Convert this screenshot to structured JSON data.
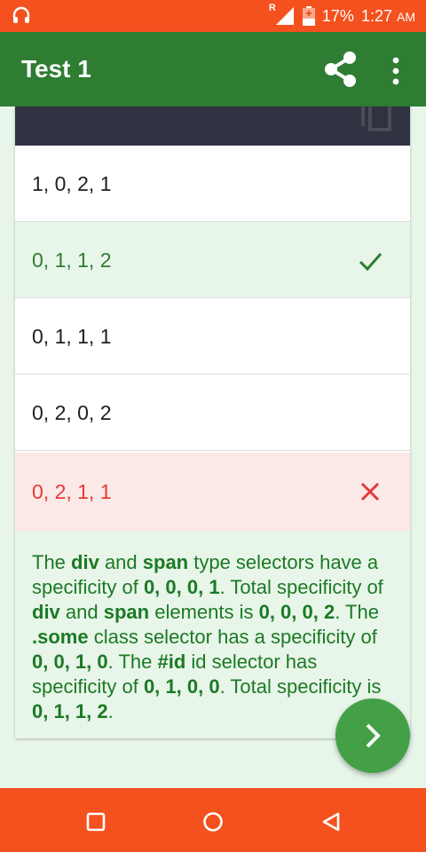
{
  "status_bar": {
    "roaming_label": "R",
    "battery": "17%",
    "time": "1:27",
    "time_suffix": "AM",
    "icons": [
      "headset-icon",
      "signal-icon",
      "battery-charging-icon"
    ]
  },
  "app_bar": {
    "title": "Test 1",
    "icons": [
      "share-icon",
      "more-vert-icon"
    ]
  },
  "options": [
    {
      "text": "1, 0, 2, 1",
      "state": "neutral"
    },
    {
      "text": "0, 1, 1, 2",
      "state": "correct",
      "mark_icon": "check-icon"
    },
    {
      "text": "0, 1, 1, 1",
      "state": "neutral"
    },
    {
      "text": "0, 2, 0, 2",
      "state": "neutral"
    },
    {
      "text": "0, 2, 1, 1",
      "state": "wrong",
      "mark_icon": "close-icon"
    }
  ],
  "explanation": [
    {
      "text": "The ",
      "bold": false
    },
    {
      "text": "div",
      "bold": true
    },
    {
      "text": " and ",
      "bold": false
    },
    {
      "text": "span",
      "bold": true
    },
    {
      "text": " type selectors have a specificity of ",
      "bold": false
    },
    {
      "text": "0, 0, 0, 1",
      "bold": true
    },
    {
      "text": ". Total specificity of ",
      "bold": false
    },
    {
      "text": "div",
      "bold": true
    },
    {
      "text": " and ",
      "bold": false
    },
    {
      "text": "span",
      "bold": true
    },
    {
      "text": " elements is ",
      "bold": false
    },
    {
      "text": "0, 0, 0, 2",
      "bold": true
    },
    {
      "text": ". The ",
      "bold": false
    },
    {
      "text": ".some",
      "bold": true
    },
    {
      "text": " class selector has a specificity of ",
      "bold": false
    },
    {
      "text": "0, 0, 1, 0",
      "bold": true
    },
    {
      "text": ". The ",
      "bold": false
    },
    {
      "text": "#id",
      "bold": true
    },
    {
      "text": " id selector has specificity of ",
      "bold": false
    },
    {
      "text": "0, 1, 0, 0",
      "bold": true
    },
    {
      "text": ". Total specificity is ",
      "bold": false
    },
    {
      "text": "0, 1, 1, 2",
      "bold": true
    },
    {
      "text": ".",
      "bold": false
    }
  ],
  "fab": {
    "icon": "chevron-right-icon"
  },
  "nav_bar": {
    "icons": [
      "recents-square-icon",
      "home-circle-icon",
      "back-triangle-icon"
    ]
  },
  "colors": {
    "status_bar": "#f4511e",
    "app_bar": "#2e7d32",
    "correct_text": "#2e7d32",
    "correct_bg": "#e8f5e9",
    "wrong_text": "#e53935",
    "wrong_bg": "#fbe9e7",
    "fab": "#43a047",
    "code_header": "#303241"
  }
}
